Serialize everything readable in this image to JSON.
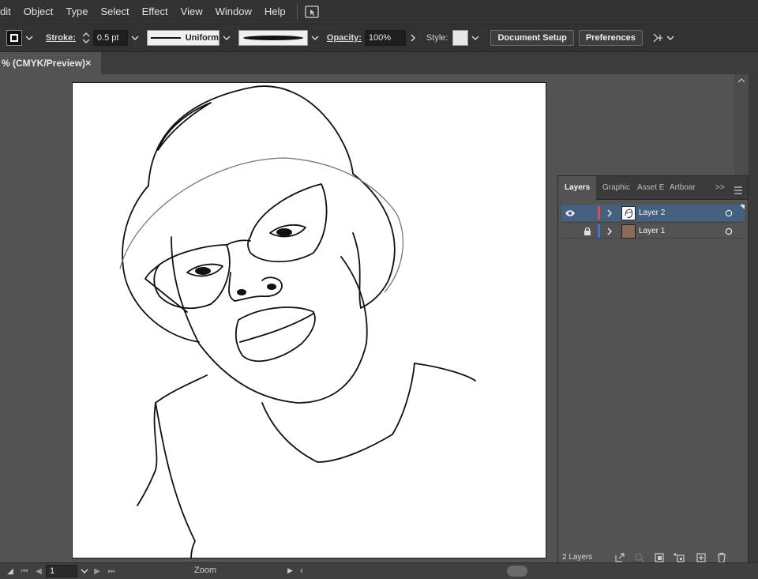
{
  "menubar": {
    "items": [
      "dit",
      "Object",
      "Type",
      "Select",
      "Effect",
      "View",
      "Window",
      "Help"
    ],
    "icon": "touch-workspace-icon"
  },
  "controlbar": {
    "stroke_label": "Stroke:",
    "stroke_value": "0.5 pt",
    "profile_label": "Uniform",
    "opacity_label": "Opacity:",
    "opacity_value": "100%",
    "style_label": "Style:",
    "document_setup": "Document Setup",
    "preferences": "Preferences"
  },
  "document_tab": {
    "title": "% (CMYK/Preview)",
    "close": "×"
  },
  "statusbar": {
    "page_value": "1",
    "zoom_label": "Zoom"
  },
  "layers_panel": {
    "tabs": [
      "Layers",
      "Graphic",
      "Asset E",
      "Artboar"
    ],
    "overflow": ">>",
    "layers": [
      {
        "name": "Layer 2",
        "color": "#e04a4a",
        "selected": true,
        "visible": true,
        "locked": false
      },
      {
        "name": "Layer 1",
        "color": "#4a6ee0",
        "selected": false,
        "visible": false,
        "locked": true
      }
    ],
    "footer_count": "2 Layers"
  },
  "colors": {
    "app_dark": "#323232",
    "workspace": "#535353",
    "selection": "#46607f"
  }
}
